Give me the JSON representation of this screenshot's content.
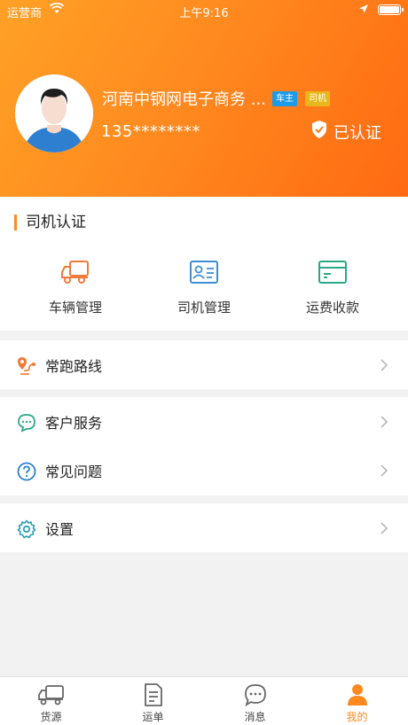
{
  "status_bar": {
    "carrier": "运营商",
    "time": "上午9:16"
  },
  "profile": {
    "company_name": "河南中钢网电子商务 ...",
    "badge_owner": "车主",
    "badge_driver": "司机",
    "phone": "135********",
    "verified_label": "已认证"
  },
  "driver_cert": {
    "title": "司机认证",
    "items": [
      {
        "label": "车辆管理",
        "icon": "truck-icon"
      },
      {
        "label": "司机管理",
        "icon": "id-card-icon"
      },
      {
        "label": "运费收款",
        "icon": "bank-card-icon"
      }
    ]
  },
  "menu": {
    "routes": "常跑路线",
    "customer_service": "客户服务",
    "faq": "常见问题",
    "settings": "设置"
  },
  "tabbar": {
    "tabs": [
      {
        "label": "货源",
        "icon": "truck-icon"
      },
      {
        "label": "运单",
        "icon": "document-icon"
      },
      {
        "label": "消息",
        "icon": "chat-icon"
      },
      {
        "label": "我的",
        "icon": "person-icon"
      }
    ],
    "active_index": 3
  },
  "colors": {
    "accent": "#ff8a1f",
    "owner_badge": "#1e9be6",
    "driver_badge": "#e8b71b"
  }
}
